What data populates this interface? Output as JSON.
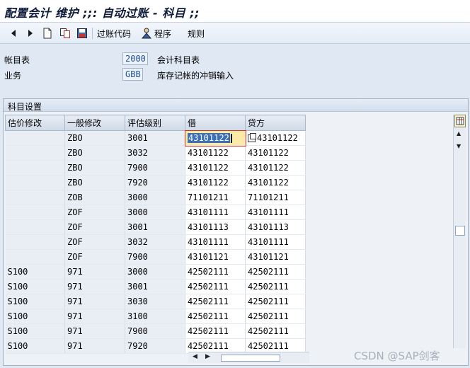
{
  "window": {
    "title": "配置会计 维护 ;;: 自动过账 - 科目 ;;"
  },
  "toolbar": {
    "posting_code_label": "过账代码",
    "program_label": "程序",
    "rules_label": "规则"
  },
  "header_fields": [
    {
      "label": "帐目表",
      "value": "2000",
      "description": "会计科目表"
    },
    {
      "label": "业务",
      "value": "GBB",
      "description": "库存记帐的冲销输入"
    }
  ],
  "group": {
    "title": "科目设置"
  },
  "table": {
    "columns": [
      "估价修改",
      "一般修改",
      "评估级别",
      "借",
      "贷方"
    ],
    "rows": [
      [
        "",
        "ZBO",
        "3001",
        "43101122",
        "43101122"
      ],
      [
        "",
        "ZBO",
        "3032",
        "43101122",
        "43101122"
      ],
      [
        "",
        "ZBO",
        "7900",
        "43101122",
        "43101122"
      ],
      [
        "",
        "ZBO",
        "7920",
        "43101122",
        "43101122"
      ],
      [
        "",
        "ZOB",
        "3000",
        "71101211",
        "71101211"
      ],
      [
        "",
        "ZOF",
        "3000",
        "43101111",
        "43101111"
      ],
      [
        "",
        "ZOF",
        "3001",
        "43101113",
        "43101113"
      ],
      [
        "",
        "ZOF",
        "3032",
        "43101111",
        "43101111"
      ],
      [
        "",
        "ZOF",
        "7900",
        "43101121",
        "43101121"
      ],
      [
        "S100",
        "971",
        "3000",
        "42502111",
        "42502111"
      ],
      [
        "S100",
        "971",
        "3001",
        "42502111",
        "42502111"
      ],
      [
        "S100",
        "971",
        "3030",
        "42502111",
        "42502111"
      ],
      [
        "S100",
        "971",
        "3100",
        "42502111",
        "42502111"
      ],
      [
        "S100",
        "971",
        "7900",
        "42502111",
        "42502111"
      ],
      [
        "S100",
        "971",
        "7920",
        "42502111",
        "42502111"
      ]
    ]
  },
  "watermark": "CSDN @SAP剑客",
  "colors": {
    "background": "#dfe8f3",
    "selected_cell": "#ffe9a6",
    "field_value_text": "#1a4f9c"
  },
  "icons": [
    "back-icon",
    "forward-icon",
    "new-entry-icon",
    "copy-icon",
    "save-icon",
    "program-icon",
    "table-settings-icon"
  ]
}
